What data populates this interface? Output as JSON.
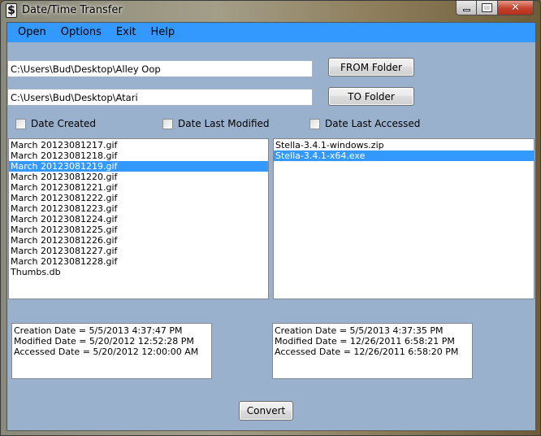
{
  "window": {
    "title": "Date/Time Transfer",
    "app_icon_glyph": "$",
    "minimize_icon": "minimize-icon",
    "maximize_icon": "maximize-icon",
    "close_icon": "close-icon",
    "close_glyph": "✕"
  },
  "menu": {
    "items": [
      "Open",
      "Options",
      "Exit",
      "Help"
    ]
  },
  "paths": {
    "from_path": "C:\\Users\\Bud\\Desktop\\Alley Oop",
    "to_path": "C:\\Users\\Bud\\Desktop\\Atari",
    "from_button": "FROM Folder",
    "to_button": "TO Folder"
  },
  "options": {
    "date_created": {
      "label": "Date Created",
      "checked": false
    },
    "date_modified": {
      "label": "Date Last Modified",
      "checked": false
    },
    "date_accessed": {
      "label": "Date Last Accessed",
      "checked": false
    }
  },
  "from_list": {
    "items": [
      "March 20123081217.gif",
      "March 20123081218.gif",
      "March 20123081219.gif",
      "March 20123081220.gif",
      "March 20123081221.gif",
      "March 20123081222.gif",
      "March 20123081223.gif",
      "March 20123081224.gif",
      "March 20123081225.gif",
      "March 20123081226.gif",
      "March 20123081227.gif",
      "March 20123081228.gif",
      "Thumbs.db"
    ],
    "selected_index": 2
  },
  "to_list": {
    "items": [
      "Stella-3.4.1-windows.zip",
      "Stella-3.4.1-x64.exe"
    ],
    "selected_index": 1
  },
  "from_info": {
    "lines": [
      "Creation Date = 5/5/2013 4:37:47 PM",
      "Modified Date = 5/20/2012 12:52:28 PM",
      "Accessed Date = 5/20/2012 12:00:00 AM"
    ]
  },
  "to_info": {
    "lines": [
      "Creation Date = 5/5/2013 4:37:35 PM",
      "Modified Date = 12/26/2011 6:58:21 PM",
      "Accessed Date = 12/26/2011 6:58:20 PM"
    ]
  },
  "actions": {
    "convert_label": "Convert"
  },
  "colors": {
    "client_bg": "#9ab1cd",
    "menubar_bg": "#3399ff",
    "selection_bg": "#3399ff"
  }
}
